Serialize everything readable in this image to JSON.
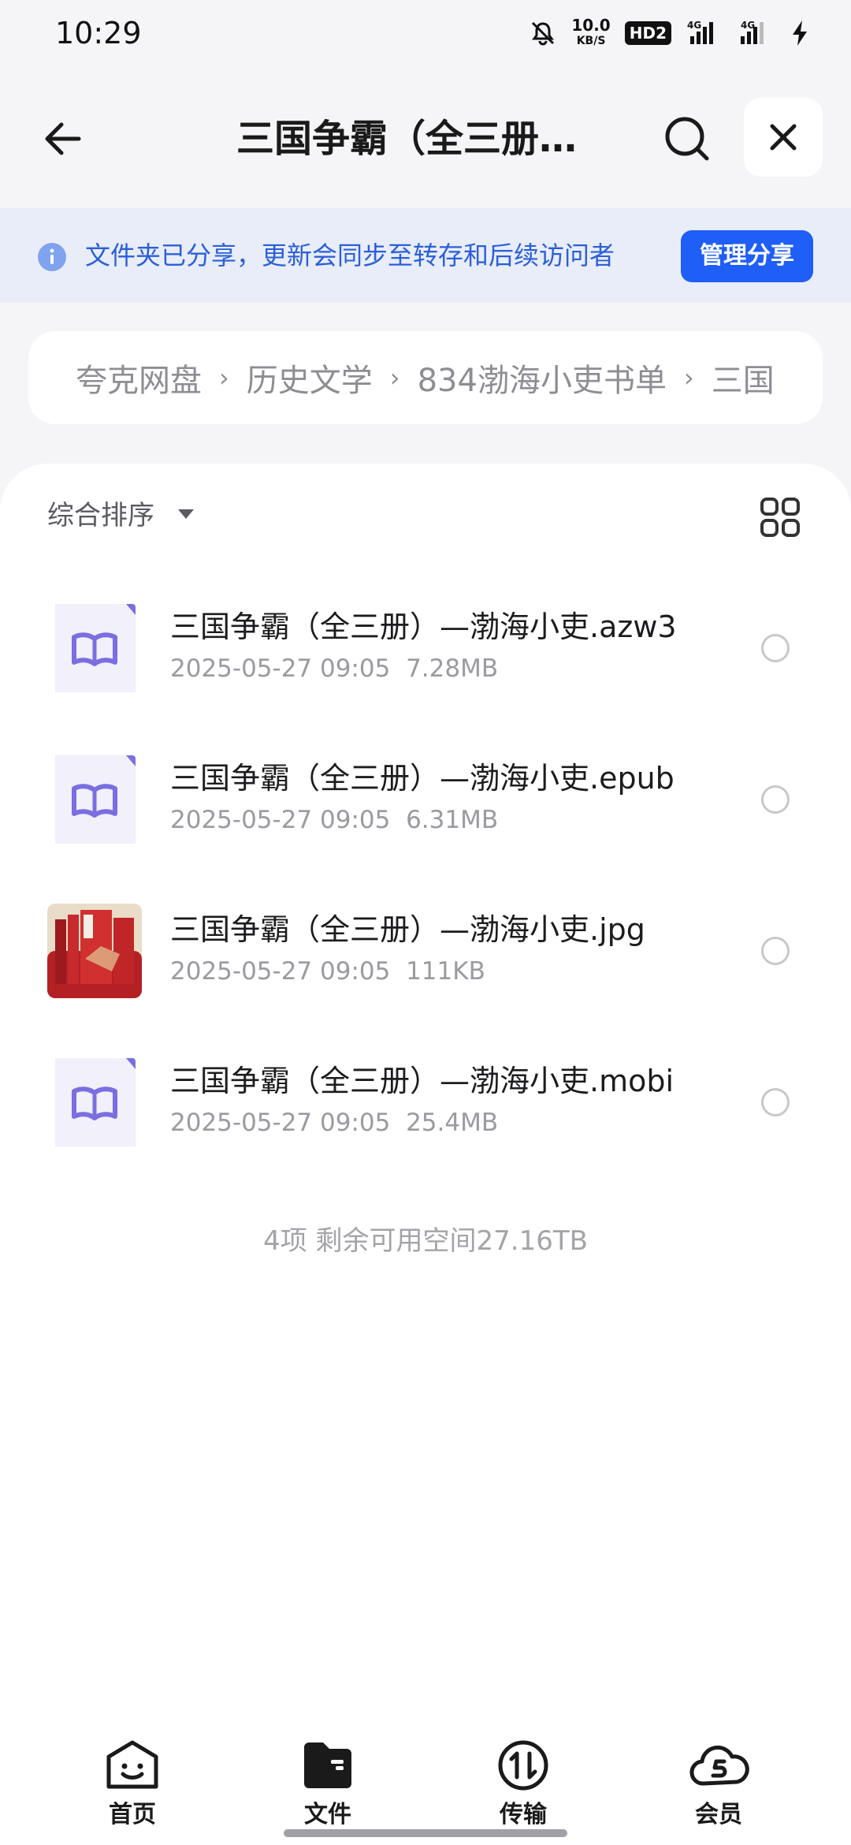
{
  "status_bar": {
    "time": "10:29",
    "net_speed": "10.0",
    "net_speed_unit": "KB/S",
    "hd_badge": "HD2",
    "network_1": "4G",
    "network_2": "4G"
  },
  "header": {
    "title": "三国争霸（全三册…",
    "icons": {
      "back": "arrow-left-icon",
      "search": "search-icon",
      "close": "close-icon"
    }
  },
  "share_banner": {
    "text": "文件夹已分享，更新会同步至转存和后续访问者",
    "button": "管理分享",
    "accent": "#1f5ef7"
  },
  "breadcrumb": {
    "items": [
      "夸克网盘",
      "历史文学",
      "834渤海小吏书单",
      "三国"
    ]
  },
  "toolbar": {
    "sort_label": "综合排序"
  },
  "files": [
    {
      "name": "三国争霸（全三册）—渤海小吏.azw3",
      "date": "2025-05-27 09:05",
      "size": "7.28MB",
      "type": "book-icon"
    },
    {
      "name": "三国争霸（全三册）—渤海小吏.epub",
      "date": "2025-05-27 09:05",
      "size": "6.31MB",
      "type": "book-icon"
    },
    {
      "name": "三国争霸（全三册）—渤海小吏.jpg",
      "date": "2025-05-27 09:05",
      "size": "111KB",
      "type": "image-thumb"
    },
    {
      "name": "三国争霸（全三册）—渤海小吏.mobi",
      "date": "2025-05-27 09:05",
      "size": "25.4MB",
      "type": "book-icon"
    }
  ],
  "summary": "4项 剩余可用空间27.16TB",
  "bottom_nav": {
    "items": [
      {
        "label": "首页",
        "icon": "smile-face-icon"
      },
      {
        "label": "文件",
        "icon": "folder-icon"
      },
      {
        "label": "传输",
        "icon": "transfer-icon"
      },
      {
        "label": "会员",
        "icon": "member-cloud-icon"
      }
    ]
  }
}
